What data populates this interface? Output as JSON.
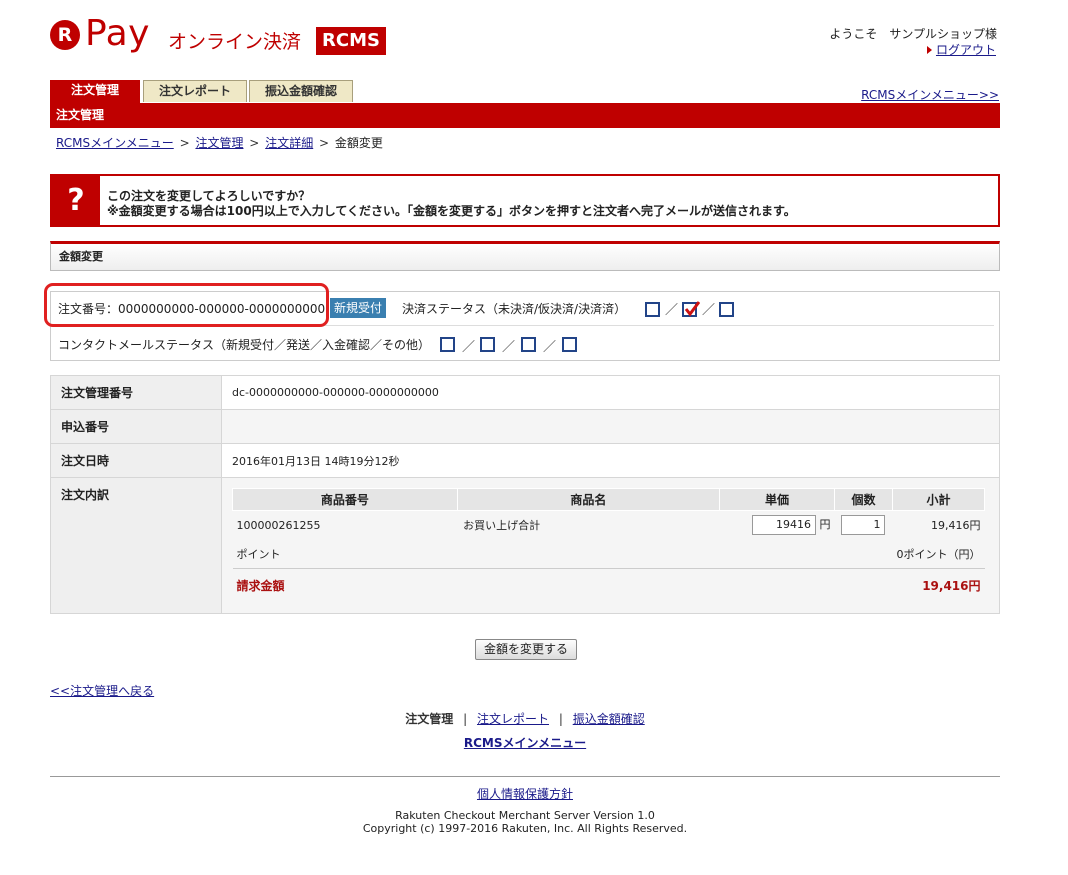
{
  "header": {
    "logo_r": "R",
    "logo_pay": "Pay",
    "logo_subtitle": "オンライン決済",
    "logo_rcms": "RCMS",
    "welcome": "ようこそ　サンプルショップ様",
    "logout": "ログアウト"
  },
  "tabs": [
    {
      "label": "注文管理",
      "active": true
    },
    {
      "label": "注文レポート",
      "active": false
    },
    {
      "label": "振込金額確認",
      "active": false
    }
  ],
  "rcms_menu_top": "RCMSメインメニュー>>",
  "page_bar_title": "注文管理",
  "breadcrumb": {
    "items": [
      "RCMSメインメニュー",
      "注文管理",
      "注文詳細"
    ],
    "current": "金額変更",
    "separator": ">"
  },
  "confirm": {
    "icon": "?",
    "line1": "この注文を変更してよろしいですか？",
    "line2": "※金額変更する場合は100円以上で入力してください。「金額を変更する」ボタンを押すと注文者へ完了メールが送信されます。"
  },
  "section_title": "金額変更",
  "status": {
    "order_number_label": "注文番号：0000000000-000000-0000000000",
    "badge": "新規受付",
    "settlement_label": "決済ステータス（未決済/仮決済/決済済）",
    "settlement_checks": [
      false,
      true,
      false
    ],
    "contact_mail_label": "コンタクトメールステータス（新規受付／発送／入金確認／その他）",
    "contact_mail_checks": [
      false,
      false,
      false,
      false
    ],
    "slash": "／"
  },
  "details": {
    "rows": [
      {
        "label": "注文管理番号",
        "value": "dc-0000000000-000000-0000000000"
      },
      {
        "label": "申込番号",
        "value": ""
      },
      {
        "label": "注文日時",
        "value": "2016年01月13日 14時19分12秒"
      }
    ],
    "breakdown_label": "注文内訳",
    "columns": [
      "商品番号",
      "商品名",
      "単価",
      "個数",
      "小計"
    ],
    "item": {
      "product_number": "100000261255",
      "product_name": "お買い上げ合計",
      "unit_price": "19416",
      "yen": "円",
      "quantity": "1",
      "subtotal": "19,416円"
    },
    "points": {
      "label": "ポイント",
      "value": "0ポイント（円）"
    },
    "total": {
      "label": "請求金額",
      "value": "19,416円"
    }
  },
  "buttons": {
    "change_amount": "金額を変更する"
  },
  "footer": {
    "back": "<<注文管理へ戻る",
    "nav_current": "注文管理",
    "nav_links": [
      "注文レポート",
      "振込金額確認"
    ],
    "nav_separator": "|",
    "rcms_menu": "RCMSメインメニュー",
    "privacy": "個人情報保護方針",
    "version": "Rakuten Checkout Merchant Server Version 1.0",
    "copyright": "Copyright (c) 1997-2016 Rakuten, Inc. All Rights Reserved."
  },
  "colors": {
    "brand_red": "#bf0000",
    "badge_blue": "#3a7fb0",
    "link": "#1a1a8a"
  }
}
